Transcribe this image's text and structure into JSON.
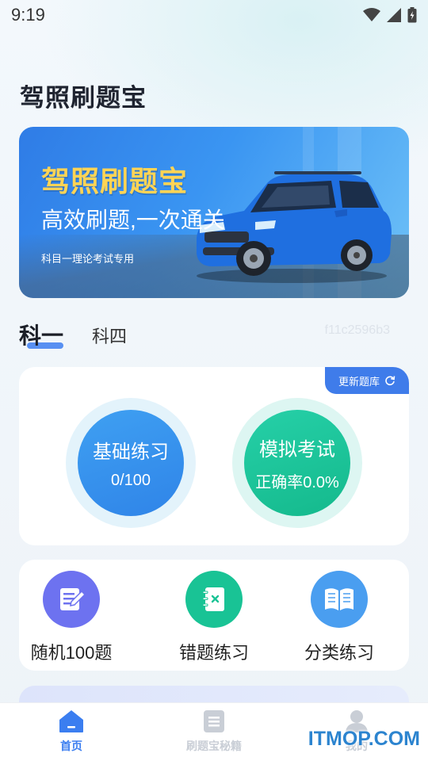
{
  "status_bar": {
    "time": "9:19"
  },
  "app": {
    "title": "驾照刷题宝"
  },
  "banner": {
    "title": "驾照刷题宝",
    "slogan": "高效刷题,一次通关",
    "subtitle": "科目一理论考试专用"
  },
  "subject_tabs": {
    "active": "科一",
    "inactive": "科四",
    "code": "f11c2596b3"
  },
  "practice": {
    "update_label": "更新题库",
    "basic": {
      "title": "基础练习",
      "progress": "0/100"
    },
    "mock": {
      "title": "模拟考试",
      "accuracy": "正确率0.0%"
    }
  },
  "tools": [
    {
      "label": "随机100题",
      "icon": "edit-note-icon",
      "color": "#6d72f0"
    },
    {
      "label": "错题练习",
      "icon": "wrong-notebook-icon",
      "color": "#19c395"
    },
    {
      "label": "分类练习",
      "icon": "open-book-icon",
      "color": "#4a9ef0"
    }
  ],
  "bottom_nav": [
    {
      "label": "首页",
      "icon": "home-icon",
      "active": true
    },
    {
      "label": "刷题宝秘籍",
      "icon": "document-icon",
      "active": false
    },
    {
      "label": "我的",
      "icon": "profile-icon",
      "active": false
    }
  ],
  "watermark": "ITMOP.COM",
  "colors": {
    "accent": "#3b7ef0",
    "basic_circle": "#2f84e8",
    "mock_circle": "#14b98c",
    "banner_title": "#ffd455"
  }
}
